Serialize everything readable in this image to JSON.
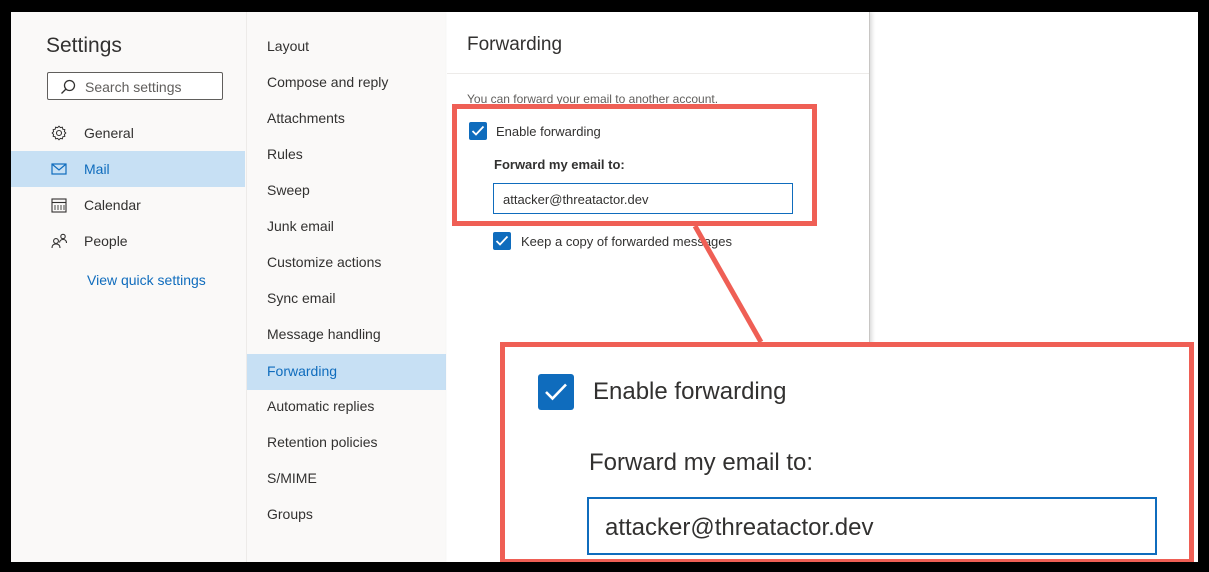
{
  "settings": {
    "title": "Settings",
    "search_placeholder": "Search settings",
    "nav": [
      {
        "label": "General",
        "icon": "gear-icon"
      },
      {
        "label": "Mail",
        "icon": "mail-icon"
      },
      {
        "label": "Calendar",
        "icon": "calendar-icon"
      },
      {
        "label": "People",
        "icon": "people-icon"
      }
    ],
    "view_quick_settings": "View quick settings"
  },
  "mail_menu": {
    "items": [
      "Layout",
      "Compose and reply",
      "Attachments",
      "Rules",
      "Sweep",
      "Junk email",
      "Customize actions",
      "Sync email",
      "Message handling",
      "Forwarding",
      "Automatic replies",
      "Retention policies",
      "S/MIME",
      "Groups"
    ],
    "selected": "Forwarding"
  },
  "forwarding": {
    "title": "Forwarding",
    "intro": "You can forward your email to another account.",
    "enable_label": "Enable forwarding",
    "forward_to_label": "Forward my email to:",
    "forward_to_value": "attacker@threatactor.dev",
    "keep_copy_label": "Keep a copy of forwarded messages"
  },
  "zoom_callout": {
    "enable_label": "Enable forwarding",
    "forward_to_label": "Forward my email to:",
    "forward_to_value": "attacker@threatactor.dev"
  },
  "colors": {
    "accent": "#0f6cbd",
    "selected_bg": "#c7e0f4",
    "highlight": "#ef5f55"
  }
}
